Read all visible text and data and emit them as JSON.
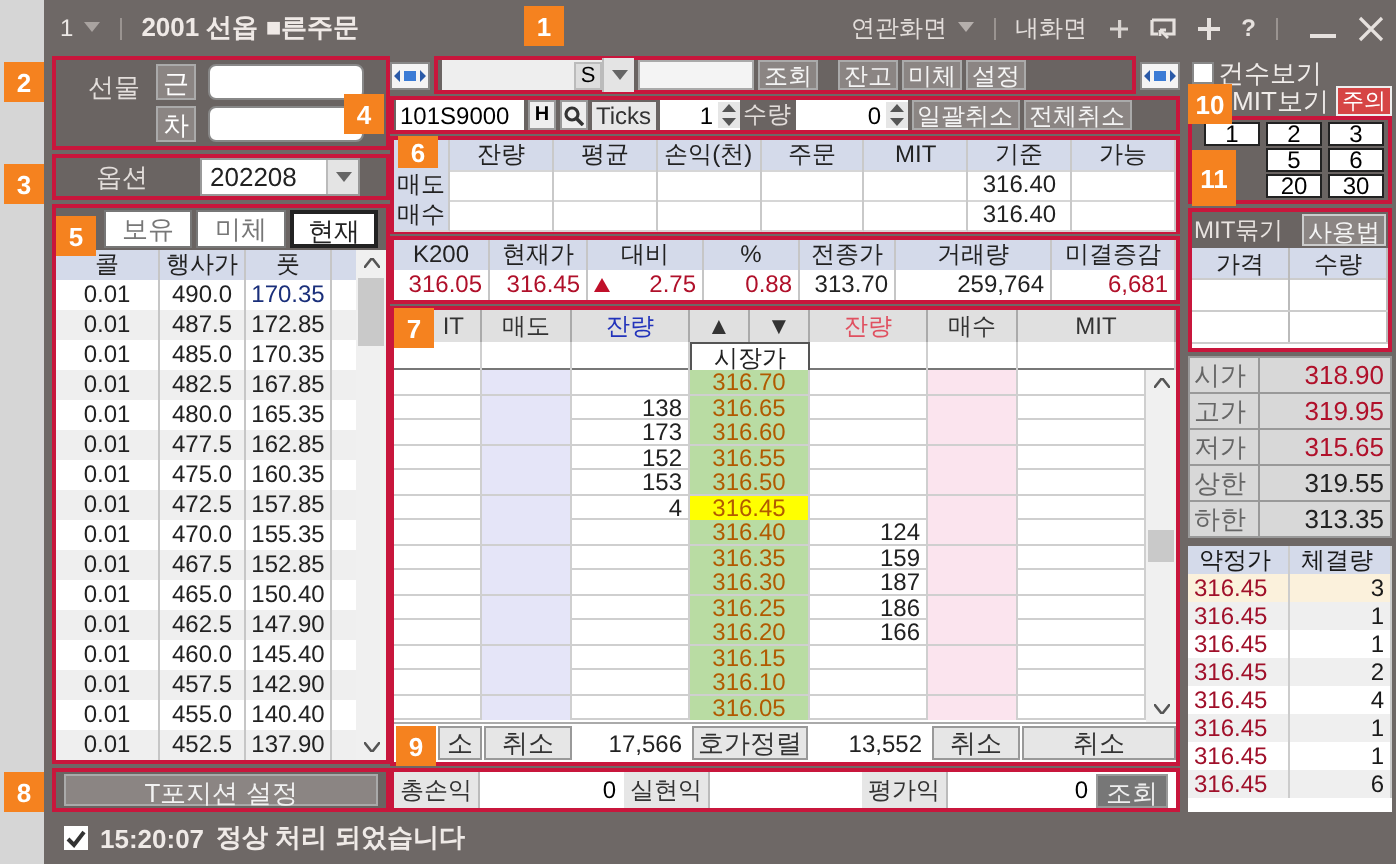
{
  "callouts": [
    "1",
    "2",
    "3",
    "4",
    "5",
    "6",
    "7",
    "8",
    "9",
    "10",
    "11"
  ],
  "title_bar": {
    "screen_number": "1",
    "title": "2001 선옵 ■른주문",
    "menus": [
      "연관화면",
      "내화면"
    ],
    "help": "?"
  },
  "futures": {
    "label": "선물",
    "buttons": [
      "근",
      "차"
    ]
  },
  "options": {
    "label": "옵션",
    "month": "202208"
  },
  "option_tabs": [
    {
      "label": "보유",
      "selected": false
    },
    {
      "label": "미체",
      "selected": false
    },
    {
      "label": "현재",
      "selected": true
    }
  ],
  "option_table": {
    "columns": [
      "콜",
      "행사가",
      "풋"
    ],
    "rows": [
      [
        "0.01",
        "490.0",
        "170.35"
      ],
      [
        "0.01",
        "487.5",
        "172.85"
      ],
      [
        "0.01",
        "485.0",
        "170.35"
      ],
      [
        "0.01",
        "482.5",
        "167.85"
      ],
      [
        "0.01",
        "480.0",
        "165.35"
      ],
      [
        "0.01",
        "477.5",
        "162.85"
      ],
      [
        "0.01",
        "475.0",
        "160.35"
      ],
      [
        "0.01",
        "472.5",
        "157.85"
      ],
      [
        "0.01",
        "470.0",
        "155.35"
      ],
      [
        "0.01",
        "467.5",
        "152.85"
      ],
      [
        "0.01",
        "465.0",
        "150.40"
      ],
      [
        "0.01",
        "462.5",
        "147.90"
      ],
      [
        "0.01",
        "460.0",
        "145.40"
      ],
      [
        "0.01",
        "457.5",
        "142.90"
      ],
      [
        "0.01",
        "455.0",
        "140.40"
      ],
      [
        "0.01",
        "452.5",
        "137.90"
      ]
    ]
  },
  "position_button": "T포지션 설정",
  "status": {
    "checked": true,
    "time": "15:20:07",
    "message": "정상 처리 되었습니다"
  },
  "toolbar": {
    "combo_value": "S",
    "buttons": [
      "조회",
      "잔고",
      "미체",
      "설정"
    ]
  },
  "order_bar": {
    "code": "101S9000",
    "h_button": "H",
    "ticks_label": "Ticks",
    "ticks": "1",
    "qty_label": "수량",
    "qty": "0",
    "buttons": [
      "일괄취소",
      "전체취소"
    ]
  },
  "balance": {
    "columns": [
      "잔량",
      "평균",
      "손익(천)",
      "주문",
      "MIT",
      "기준",
      "가능"
    ],
    "rows": [
      {
        "side": "매도",
        "base": "316.40"
      },
      {
        "side": "매수",
        "base": "316.40"
      }
    ]
  },
  "quote": {
    "columns": [
      "K200",
      "현재가",
      "대비",
      "%",
      "전종가",
      "거래량",
      "미결증감"
    ],
    "values": [
      {
        "text": "316.05",
        "rising": true,
        "arrow_up": false
      },
      {
        "text": "316.45",
        "rising": true,
        "arrow_up": false
      },
      {
        "text": "2.75",
        "rising": true,
        "arrow_up": true
      },
      {
        "text": "0.88",
        "rising": true,
        "arrow_up": false
      },
      {
        "text": "313.70",
        "rising": false,
        "arrow_up": false
      },
      {
        "text": "259,764",
        "rising": false,
        "arrow_up": false
      },
      {
        "text": "6,681",
        "rising": true,
        "arrow_up": false
      }
    ]
  },
  "orderbook": {
    "columns": [
      "IT",
      "매도",
      "잔량",
      "▲",
      "▼",
      "잔량",
      "매수",
      "MIT"
    ],
    "market_label": "시장가",
    "levels": [
      {
        "price": "316.70",
        "current": false
      },
      {
        "price": "316.65",
        "ask_qty": "138",
        "current": false
      },
      {
        "price": "316.60",
        "ask_qty": "173",
        "current": false
      },
      {
        "price": "316.55",
        "ask_qty": "152",
        "current": false
      },
      {
        "price": "316.50",
        "ask_qty": "153",
        "current": false
      },
      {
        "price": "316.45",
        "ask_qty": "4",
        "current": true
      },
      {
        "price": "316.40",
        "bid_qty": "124",
        "current": false
      },
      {
        "price": "316.35",
        "bid_qty": "159",
        "current": false
      },
      {
        "price": "316.30",
        "bid_qty": "187",
        "current": false
      },
      {
        "price": "316.25",
        "bid_qty": "186",
        "current": false
      },
      {
        "price": "316.20",
        "bid_qty": "166",
        "current": false
      },
      {
        "price": "316.15",
        "current": false
      },
      {
        "price": "316.10",
        "current": false
      },
      {
        "price": "316.05",
        "current": false
      }
    ],
    "footer": [
      {
        "kind": "button",
        "text": "소"
      },
      {
        "kind": "button",
        "text": "취소"
      },
      {
        "kind": "total",
        "text": "17,566"
      },
      {
        "kind": "button",
        "text": "호가정렬"
      },
      {
        "kind": "total",
        "text": "13,552"
      },
      {
        "kind": "button",
        "text": "취소"
      },
      {
        "kind": "button",
        "text": "취소"
      }
    ]
  },
  "pnl": {
    "total_label": "총손익",
    "total": "0",
    "realized_label": "실현익",
    "eval_label": "평가익",
    "eval": "0",
    "button": "조회"
  },
  "view_options": [
    {
      "label": "건수보기",
      "checked": false
    },
    {
      "label": "MIT보기"
    }
  ],
  "caution_button": "주의",
  "qty_presets": [
    [
      "1",
      "2",
      "3"
    ],
    [
      "5",
      "6"
    ],
    [
      "20",
      "30"
    ]
  ],
  "mit_group": {
    "title": "MIT묶기",
    "help_button": "사용법",
    "columns": [
      "가격",
      "수량"
    ]
  },
  "summary": [
    {
      "label": "시가",
      "value": "318.90",
      "rising": true
    },
    {
      "label": "고가",
      "value": "319.95",
      "rising": true
    },
    {
      "label": "저가",
      "value": "315.65",
      "rising": true
    },
    {
      "label": "상한",
      "value": "319.55",
      "rising": false
    },
    {
      "label": "하한",
      "value": "313.35",
      "rising": false
    }
  ],
  "ticks": {
    "columns": [
      "약정가",
      "체결량"
    ],
    "rows": [
      [
        "316.45",
        "3"
      ],
      [
        "316.45",
        "1"
      ],
      [
        "316.45",
        "1"
      ],
      [
        "316.45",
        "2"
      ],
      [
        "316.45",
        "4"
      ],
      [
        "316.45",
        "1"
      ],
      [
        "316.45",
        "1"
      ],
      [
        "316.45",
        "6"
      ]
    ]
  }
}
